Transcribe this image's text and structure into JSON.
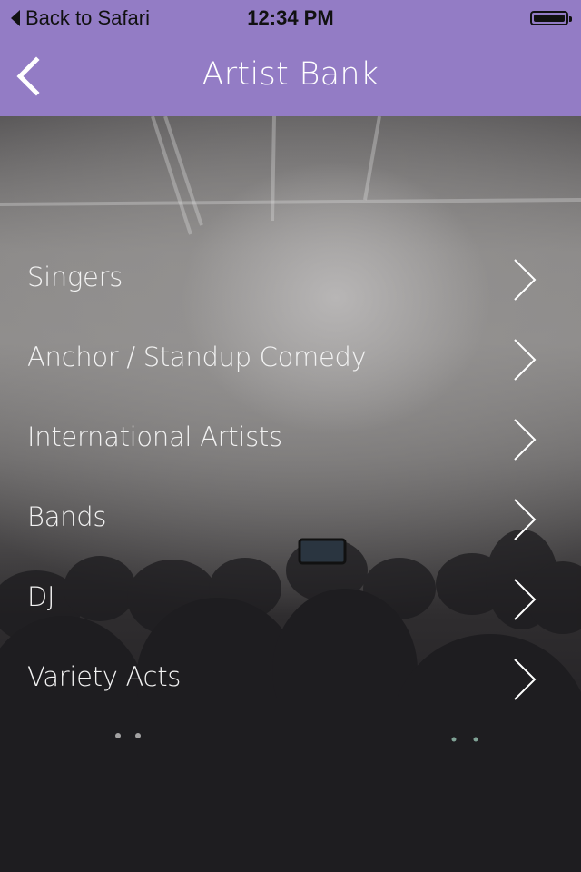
{
  "status_bar": {
    "back_label": "Back to Safari",
    "time": "12:34 PM",
    "battery_icon": "battery-full-icon"
  },
  "navbar": {
    "title": "Artist Bank",
    "back_icon": "chevron-left-icon"
  },
  "categories": [
    {
      "label": "Singers",
      "icon": "chevron-right-icon"
    },
    {
      "label": "Anchor / Standup Comedy",
      "icon": "chevron-right-icon"
    },
    {
      "label": "International Artists",
      "icon": "chevron-right-icon"
    },
    {
      "label": "Bands",
      "icon": "chevron-right-icon"
    },
    {
      "label": "DJ",
      "icon": "chevron-right-icon"
    },
    {
      "label": "Variety Acts",
      "icon": "chevron-right-icon"
    }
  ],
  "colors": {
    "brand_purple": "#937cc5",
    "text_white": "#ffffff"
  }
}
